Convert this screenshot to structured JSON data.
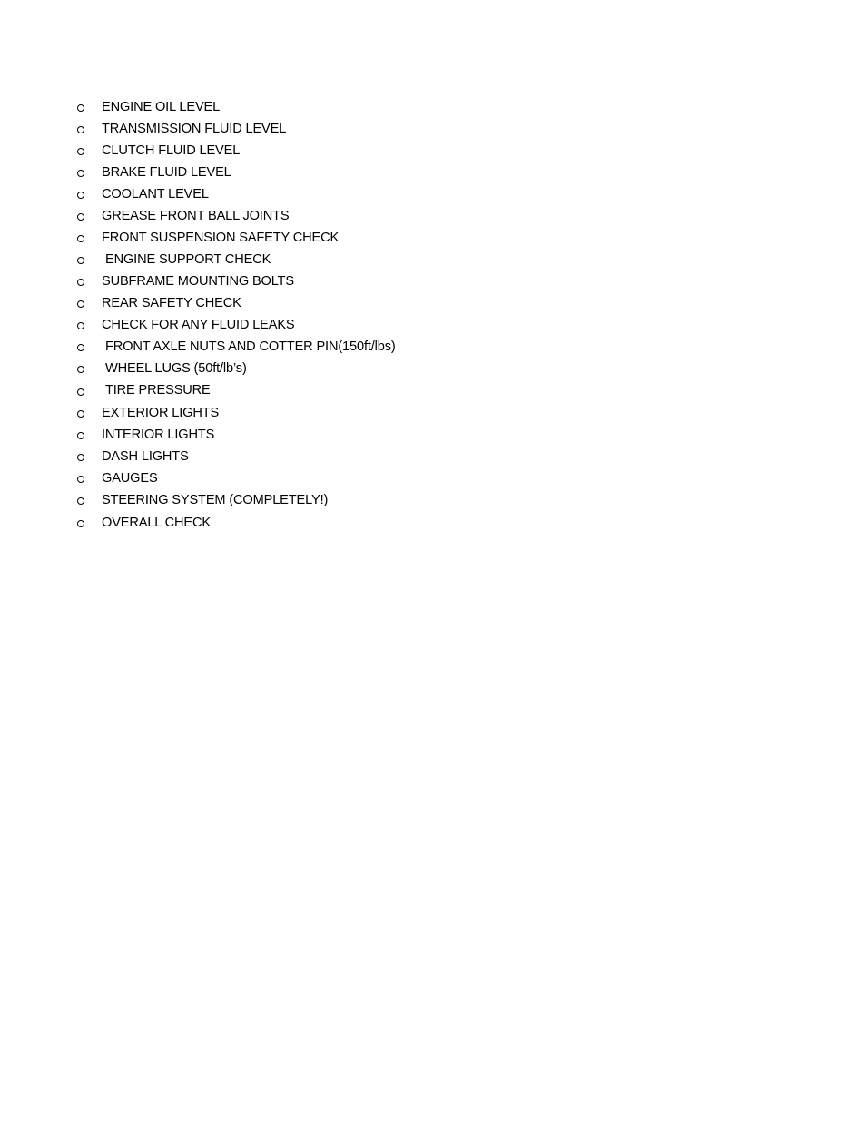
{
  "document": {
    "checklist": {
      "bullet_icon": "hollow-circle-bullet",
      "items": [
        {
          "label": "ENGINE OIL LEVEL",
          "leading_space": false
        },
        {
          "label": "TRANSMISSION FLUID LEVEL",
          "leading_space": false
        },
        {
          "label": "CLUTCH FLUID LEVEL",
          "leading_space": false
        },
        {
          "label": "BRAKE FLUID LEVEL",
          "leading_space": false
        },
        {
          "label": "COOLANT LEVEL",
          "leading_space": false
        },
        {
          "label": "GREASE FRONT BALL JOINTS",
          "leading_space": false
        },
        {
          "label": "FRONT SUSPENSION SAFETY CHECK",
          "leading_space": false
        },
        {
          "label": "ENGINE SUPPORT CHECK",
          "leading_space": true
        },
        {
          "label": "SUBFRAME MOUNTING BOLTS",
          "leading_space": false
        },
        {
          "label": "REAR SAFETY CHECK",
          "leading_space": false
        },
        {
          "label": "CHECK FOR ANY FLUID LEAKS",
          "leading_space": false
        },
        {
          "label": "FRONT AXLE NUTS AND COTTER PIN(150ft/lbs)",
          "leading_space": true
        },
        {
          "label": "WHEEL LUGS (50ft/lb’s)",
          "leading_space": true
        },
        {
          "label": "TIRE PRESSURE",
          "leading_space": true
        },
        {
          "label": "EXTERIOR LIGHTS",
          "leading_space": false
        },
        {
          "label": "INTERIOR LIGHTS",
          "leading_space": false
        },
        {
          "label": "DASH LIGHTS",
          "leading_space": false
        },
        {
          "label": "GAUGES",
          "leading_space": false
        },
        {
          "label": "STEERING SYSTEM (COMPLETELY!)",
          "leading_space": false
        },
        {
          "label": "OVERALL CHECK",
          "leading_space": false
        }
      ]
    }
  }
}
